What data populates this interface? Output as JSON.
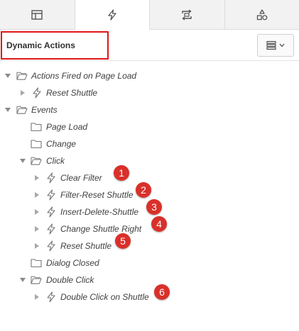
{
  "tabs": [
    {
      "icon": "table-icon"
    },
    {
      "icon": "lightning-icon"
    },
    {
      "icon": "process-icon"
    },
    {
      "icon": "shared-components-icon"
    }
  ],
  "header": {
    "title": "Dynamic Actions",
    "menu_icon": "list-menu-icon"
  },
  "tree": {
    "actions_fired_on_page_load": "Actions Fired on Page Load",
    "reset_shuttle_1": "Reset Shuttle",
    "events": "Events",
    "page_load": "Page Load",
    "change": "Change",
    "click": "Click",
    "clear_filter": "Clear Filter",
    "filter_reset_shuttle": "Filter-Reset Shuttle",
    "insert_delete_shuttle": "Insert-Delete-Shuttle",
    "change_shuttle_right": "Change Shuttle Right",
    "reset_shuttle_2": "Reset Shuttle",
    "dialog_closed": "Dialog Closed",
    "double_click": "Double Click",
    "double_click_on_shuttle": "Double Click on Shuttle"
  },
  "badges": [
    "1",
    "2",
    "3",
    "4",
    "5",
    "6"
  ],
  "colors": {
    "highlight_border": "#e01616",
    "badge": "#d9302a"
  }
}
